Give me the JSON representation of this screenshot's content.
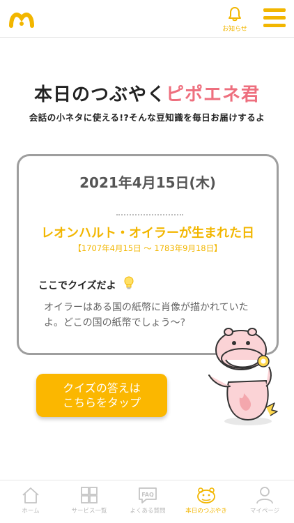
{
  "header": {
    "notification_label": "お知らせ"
  },
  "page": {
    "title_main": "本日のつぶやく",
    "title_accent": "ピポエネ君",
    "subtitle": "会話の小ネタに使える!?そんな豆知識を毎日お届けするよ"
  },
  "card": {
    "date": "2021年4月15日(木)",
    "event": "レオンハルト・オイラーが生まれた日",
    "lifespan": "【1707年4月15日 〜 1783年9月18日】",
    "quiz_heading": "ここでクイズだよ",
    "quiz_text": "オイラーはある国の紙幣に肖像が描かれていたよ。どこの国の紙幣でしょう〜?"
  },
  "answer_button": {
    "line1": "クイズの答えは",
    "line2": "こちらをタップ"
  },
  "tabs": [
    {
      "label": "ホーム",
      "icon": "home-icon"
    },
    {
      "label": "サービス一覧",
      "icon": "grid-icon"
    },
    {
      "label": "よくある質問",
      "icon": "faq-icon"
    },
    {
      "label": "本日のつぶやき",
      "icon": "hippo-icon"
    },
    {
      "label": "マイページ",
      "icon": "user-icon"
    }
  ],
  "colors": {
    "accent_yellow": "#f2b600",
    "button_yellow": "#fbb700",
    "pink": "#ee6f7e",
    "border_gray": "#9e9e9e"
  }
}
